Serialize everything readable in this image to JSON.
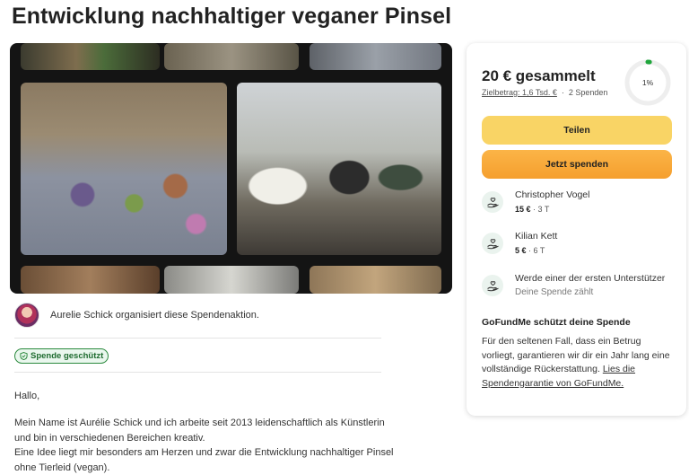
{
  "title": "Entwicklung nachhaltiger veganer Pinsel",
  "organizer": {
    "text": "Aurelie Schick organisiert diese Spendenaktion."
  },
  "badge": {
    "label": "Spende geschützt"
  },
  "story": {
    "greeting": "Hallo,",
    "paragraph1": "Mein Name ist Aurélie Schick und ich arbeite seit 2013 leidenschaftlich als Künstlerin und bin in verschiedenen Bereichen kreativ.",
    "paragraph2": "Eine Idee liegt mir besonders am Herzen und zwar die Entwicklung nachhaltiger Pinsel ohne Tierleid (vegan)."
  },
  "card": {
    "amount": "20 € gesammelt",
    "goal": "Zielbetrag: 1,6 Tsd. €",
    "donations": "2 Spenden",
    "progress_percent": 1,
    "progress_label": "1%",
    "share_label": "Teilen",
    "donate_label": "Jetzt spenden",
    "donors": [
      {
        "name": "Christopher Vogel",
        "amount": "15 €",
        "time": "3 T"
      },
      {
        "name": "Kilian Kett",
        "amount": "5 €",
        "time": "6 T"
      }
    ],
    "first_supporter": {
      "title": "Werde einer der ersten Unterstützer",
      "subtitle": "Deine Spende zählt"
    },
    "protection": {
      "title": "GoFundMe schützt deine Spende",
      "text": "Für den seltenen Fall, dass ein Betrug vorliegt, garantieren wir dir ein Jahr lang eine vollständige Rückerstattung.",
      "link": "Lies die Spendengarantie von GoFundMe."
    }
  },
  "colors": {
    "share_button": "#f9d465",
    "donate_button": "#f59f2e",
    "progress": "#1fa53b",
    "badge_green": "#2b8a3e"
  }
}
